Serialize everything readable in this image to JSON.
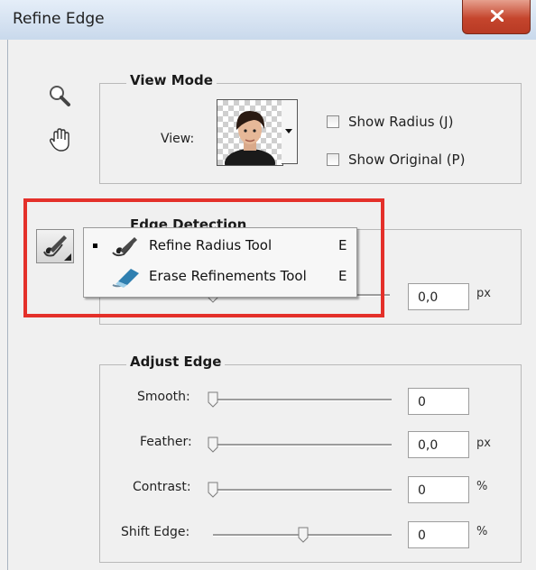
{
  "window": {
    "title": "Refine Edge"
  },
  "view_mode": {
    "legend": "View Mode",
    "view_label": "View:",
    "show_radius": "Show Radius (J)",
    "show_original": "Show Original (P)"
  },
  "edge_detection": {
    "legend": "Edge Detection",
    "radius_value": "0,0",
    "radius_unit": "px"
  },
  "tool_menu": {
    "items": [
      {
        "label": "Refine Radius Tool",
        "shortcut": "E",
        "selected": true
      },
      {
        "label": "Erase Refinements Tool",
        "shortcut": "E",
        "selected": false
      }
    ]
  },
  "adjust_edge": {
    "legend": "Adjust Edge",
    "smooth": {
      "label": "Smooth:",
      "value": "0",
      "unit": ""
    },
    "feather": {
      "label": "Feather:",
      "value": "0,0",
      "unit": "px"
    },
    "contrast": {
      "label": "Contrast:",
      "value": "0",
      "unit": "%"
    },
    "shift_edge": {
      "label": "Shift Edge:",
      "value": "0",
      "unit": "%"
    }
  },
  "colors": {
    "highlight": "#e4302a",
    "close_button": "#c5452d"
  },
  "icons": [
    "zoom-icon",
    "hand-icon",
    "refine-radius-brush-icon",
    "erase-refinements-icon",
    "close-icon"
  ]
}
